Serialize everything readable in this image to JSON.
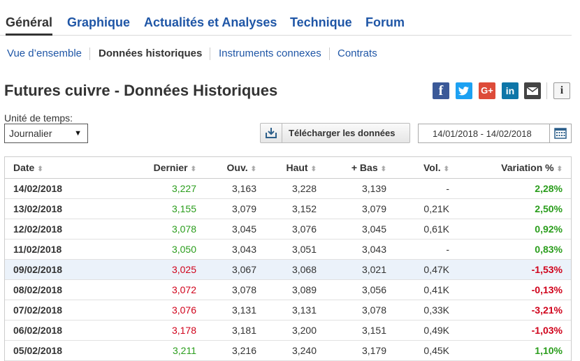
{
  "main_tabs": [
    "Général",
    "Graphique",
    "Actualités et Analyses",
    "Technique",
    "Forum"
  ],
  "sub_tabs": [
    "Vue d’ensemble",
    "Données historiques",
    "Instruments connexes",
    "Contrats"
  ],
  "page_title": "Futures cuivre - Données Historiques",
  "share": {
    "facebook": "f",
    "google": "G+",
    "linkedin": "in",
    "info": "i"
  },
  "timeframe": {
    "label": "Unité de temps:",
    "selected": "Journalier"
  },
  "download_label": "Télécharger les données",
  "date_range": "14/01/2018 - 14/02/2018",
  "colors": {
    "link": "#1f56a6",
    "up": "#2a9d1c",
    "down": "#d0021b",
    "highlight": "#ebf2fa"
  },
  "table": {
    "headers": [
      "Date",
      "Dernier",
      "Ouv.",
      "Haut",
      "+ Bas",
      "Vol.",
      "Variation %"
    ],
    "rows": [
      [
        "14/02/2018",
        "3,227",
        "3,163",
        "3,228",
        "3,139",
        "-",
        "2,28%",
        "up"
      ],
      [
        "13/02/2018",
        "3,155",
        "3,079",
        "3,152",
        "3,079",
        "0,21K",
        "2,50%",
        "up"
      ],
      [
        "12/02/2018",
        "3,078",
        "3,045",
        "3,076",
        "3,045",
        "0,61K",
        "0,92%",
        "up"
      ],
      [
        "11/02/2018",
        "3,050",
        "3,043",
        "3,051",
        "3,043",
        "-",
        "0,83%",
        "up"
      ],
      [
        "09/02/2018",
        "3,025",
        "3,067",
        "3,068",
        "3,021",
        "0,47K",
        "-1,53%",
        "down"
      ],
      [
        "08/02/2018",
        "3,072",
        "3,078",
        "3,089",
        "3,056",
        "0,41K",
        "-0,13%",
        "down"
      ],
      [
        "07/02/2018",
        "3,076",
        "3,131",
        "3,131",
        "3,078",
        "0,33K",
        "-3,21%",
        "down"
      ],
      [
        "06/02/2018",
        "3,178",
        "3,181",
        "3,200",
        "3,151",
        "0,49K",
        "-1,03%",
        "down"
      ],
      [
        "05/02/2018",
        "3,211",
        "3,216",
        "3,240",
        "3,179",
        "0,45K",
        "1,10%",
        "up"
      ]
    ]
  }
}
